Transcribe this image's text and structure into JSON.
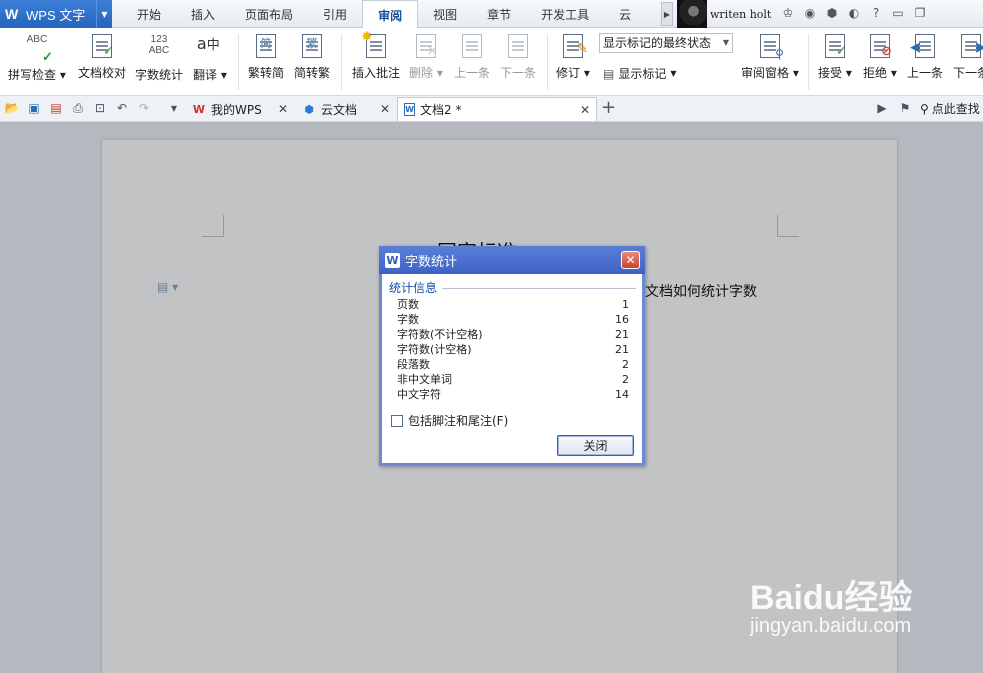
{
  "app": {
    "name": "WPS 文字"
  },
  "menu_tabs": [
    "开始",
    "插入",
    "页面布局",
    "引用",
    "审阅",
    "视图",
    "章节",
    "开发工具",
    "云"
  ],
  "active_tab": "审阅",
  "user": {
    "name": "writen holt"
  },
  "ribbon": {
    "spell_check": "拼写检查",
    "doc_proofread": "文档校对",
    "word_count": "字数统计",
    "translate": "翻译",
    "trad_to_simp": "繁转简",
    "simp_to_trad": "简转繁",
    "insert_comment": "插入批注",
    "delete": "删除",
    "prev": "上一条",
    "next": "下一条",
    "revise": "修订",
    "display_state": "显示标记的最终状态",
    "show_markup": "显示标记",
    "review_pane": "审阅窗格",
    "accept": "接受",
    "reject": "拒绝",
    "prev2": "上一条",
    "next2": "下一条",
    "icon_text_abc": "ABC",
    "icon_text_123": "123",
    "icon_text_jian": "简",
    "icon_text_fan": "繁"
  },
  "doc_tabs": [
    {
      "label": "我的WPS"
    },
    {
      "label": "云文档"
    },
    {
      "label": "文档2 *"
    }
  ],
  "search": {
    "label": "点此查找"
  },
  "document": {
    "title": "国家标准",
    "text": "文档如何统计字数"
  },
  "dialog": {
    "title": "字数统计",
    "group_label": "统计信息",
    "stats": [
      {
        "label": "页数",
        "value": "1"
      },
      {
        "label": "字数",
        "value": "16"
      },
      {
        "label": "字符数(不计空格)",
        "value": "21"
      },
      {
        "label": "字符数(计空格)",
        "value": "21"
      },
      {
        "label": "段落数",
        "value": "2"
      },
      {
        "label": "非中文单词",
        "value": "2"
      },
      {
        "label": "中文字符",
        "value": "14"
      }
    ],
    "checkbox_label": "包括脚注和尾注(F)",
    "checkbox_checked": false,
    "close_button": "关闭"
  },
  "watermark": {
    "brand": "Baidu经验",
    "url": "jingyan.baidu.com"
  },
  "colors": {
    "app_blue": "#2664be",
    "dialog_title": "#3e63c7",
    "page_gray": "#c2c3c5"
  }
}
